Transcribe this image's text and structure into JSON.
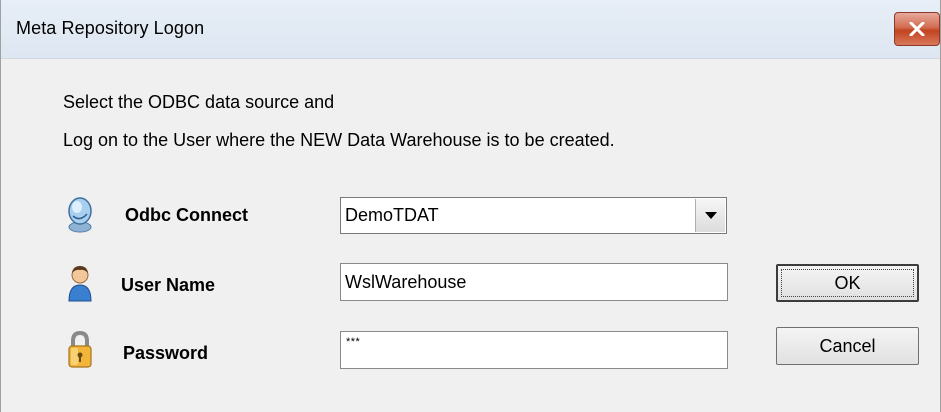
{
  "window": {
    "title": "Meta Repository Logon",
    "close_icon": "close-icon"
  },
  "message": {
    "line1": "Select the ODBC data source and",
    "line2": "Log on to the User where the NEW Data Warehouse is to be created."
  },
  "form": {
    "odbc": {
      "label": "Odbc Connect",
      "icon": "odbc-connect-icon",
      "value": "DemoTDAT"
    },
    "user": {
      "label": "User Name",
      "icon": "user-icon",
      "value": "WslWarehouse"
    },
    "password": {
      "label": "Password",
      "icon": "lock-icon",
      "value": "***"
    }
  },
  "buttons": {
    "ok": "OK",
    "cancel": "Cancel"
  },
  "colors": {
    "window_bg": "#f0f0f0",
    "close_button": "#c7482a"
  }
}
